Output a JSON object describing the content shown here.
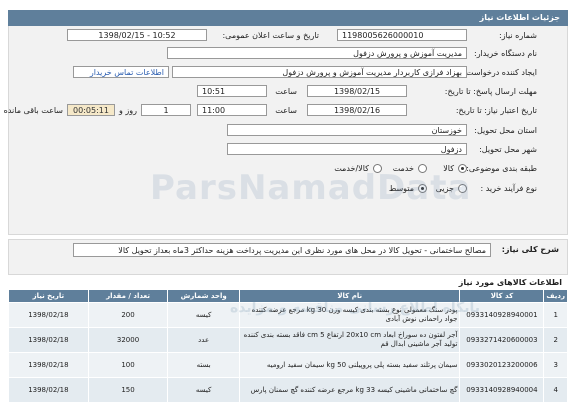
{
  "header": {
    "title": "جزئیات اطلاعات نیاز"
  },
  "form": {
    "need_number_label": "شماره نیاز:",
    "need_number": "1198005626000010",
    "announce_label": "تاریخ و ساعت اعلان عمومی:",
    "announce_value": "1398/02/15 - 10:52",
    "buyer_label": "نام دستگاه خریدار:",
    "buyer_value": "مدیریت آموزش و پرورش دزفول",
    "creator_label": "ایجاد کننده درخواست:",
    "creator_value": "بهزاد فرازی کاربردار مدیریت آموزش و پرورش دزفول",
    "contact_link": "اطلاعات تماس خریدار",
    "send_deadline_label": "مهلت ارسال پاسخ: تا تاریخ:",
    "send_date": "1398/02/15",
    "hour_label_1": "ساعت",
    "send_time": "10:51",
    "validity_label": "تاریخ اعتبار نیاز: تا تاریخ:",
    "validity_date": "1398/02/16",
    "hour_label_2": "ساعت",
    "validity_time": "11:00",
    "days_count": "1",
    "days_label": "روز و",
    "remaining_time": "00:05:11",
    "remaining_label": "ساعت باقی مانده",
    "province_label": "استان محل تحویل:",
    "province_value": "خوزستان",
    "city_label": "شهر محل تحویل:",
    "city_value": "دزفول",
    "category_label": "طبقه بندی موضوعی:",
    "category_options": [
      "کالا",
      "خدمت",
      "کالا/خدمت"
    ],
    "category_selected": "کالا",
    "process_label": "نوع فرآیند خرید :",
    "process_options": [
      "جزیی",
      "متوسط"
    ],
    "process_selected": "متوسط"
  },
  "summary": {
    "label": "شرح کلی نیاز:",
    "text": "مصالح ساختمانی - تحویل کالا در محل های مورد نظری این مدیریت پرداخت هزینه حداکثر 3ماه بعداز تحویل کالا"
  },
  "items_section_title": "اطلاعات کالاهای مورد نیاز",
  "table": {
    "headers": [
      "ردیف",
      "کد کالا",
      "نام کالا",
      "واحد شمارش",
      "تعداد / مقدار",
      "تاریخ نیاز"
    ],
    "rows": [
      [
        "1",
        "0933140928940001",
        "پودر سنگ معمولی نوع بسته بندی کیسه وزن 30 kg مرجع عرضه کننده جواد راحمانی نوش آبادی",
        "کیسه",
        "200",
        "1398/02/18"
      ],
      [
        "2",
        "0933271420600003",
        "آجر لفتون ده سوراخ ابعاد 20x10 cm ارتفاع 5 cm فاقد بسته بندی کننده تولید آجر ماشینی ابدال قم",
        "عدد",
        "32000",
        "1398/02/18"
      ],
      [
        "3",
        "0933020123200006",
        "سیمان پرتلند سفید بسته پلی پروپیلنی 50 kg سیمان سفید ارومیه",
        "بسته",
        "100",
        "1398/02/18"
      ],
      [
        "4",
        "0933140928940004",
        "گچ ساختمانی ماشینی کیسه 33 kg مرجع عرضه کننده گچ سمنان پارس",
        "کیسه",
        "150",
        "1398/02/18"
      ]
    ]
  },
  "watermark": "ParsNamadData",
  "watermark_2": "پایگاه اطلاع رسانی مناقصه و مزایده"
}
